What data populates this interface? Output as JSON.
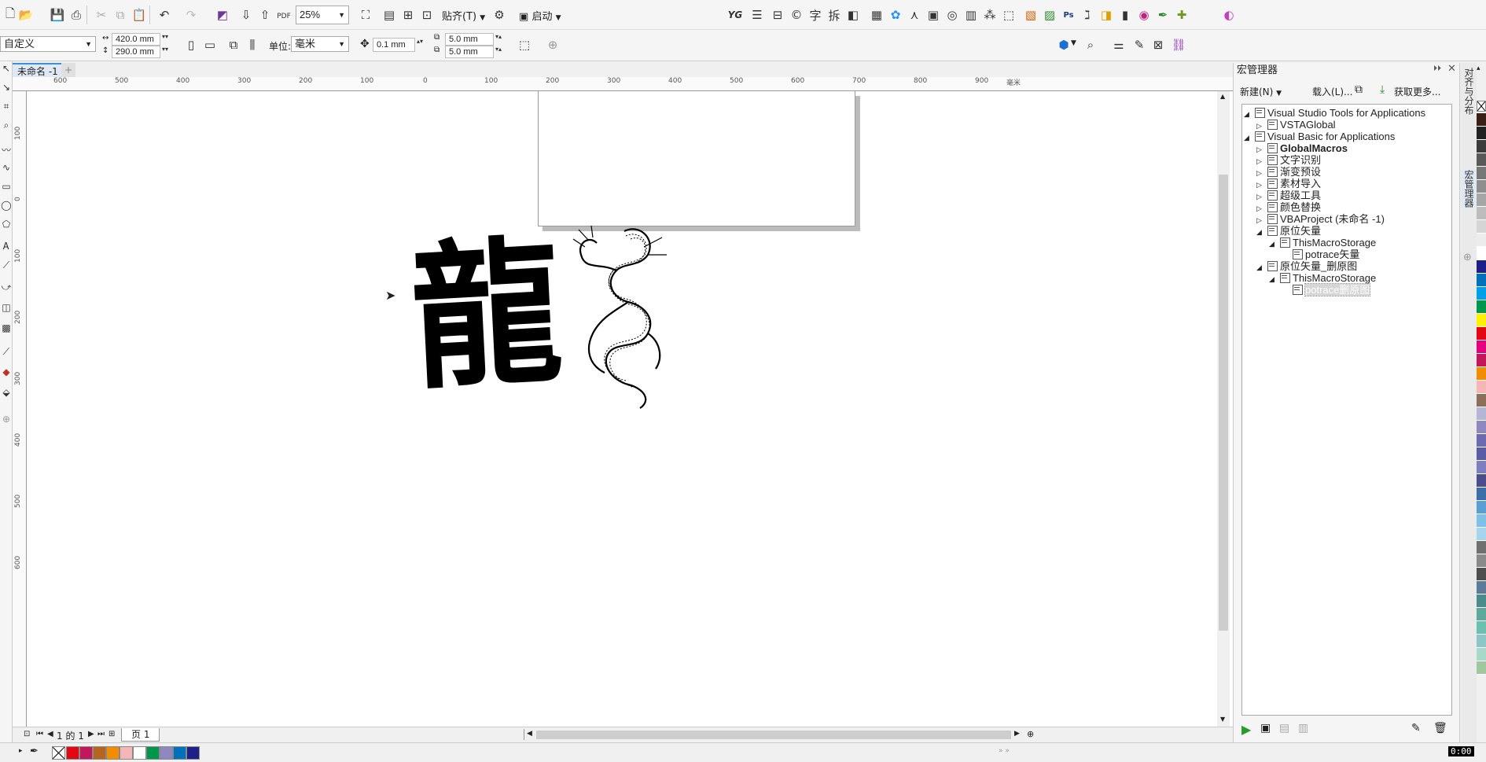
{
  "toolbar1": {
    "zoom": "25%",
    "snap_label": "贴齐(T)",
    "launch_label": "启动",
    "pdf_label": "PDF",
    "yg_label": "YG",
    "char_label": "字",
    "split_label": "拆"
  },
  "toolbar2": {
    "page_size_name": "自定义",
    "width": "420.0 mm",
    "height": "290.0 mm",
    "units_label": "单位:",
    "units_value": "毫米",
    "nudge": "0.1 mm",
    "dup_x": "5.0 mm",
    "dup_y": "5.0 mm"
  },
  "document": {
    "tab_label": "未命名 -1",
    "page_nav": "1 的 1",
    "page_tab": "页 1"
  },
  "ruler": {
    "h_labels": [
      "600",
      "500",
      "400",
      "300",
      "200",
      "100",
      "0",
      "100",
      "200",
      "300",
      "400",
      "500",
      "600",
      "700",
      "800",
      "900"
    ],
    "h_unit": "毫米",
    "v_labels": [
      "100",
      "0",
      "100",
      "200",
      "300",
      "400",
      "500",
      "600"
    ]
  },
  "canvas": {
    "calligraphy_text": "龍"
  },
  "macro_manager": {
    "title": "宏管理器",
    "new_label": "新建(N)",
    "load_label": "载入(L)...",
    "get_more_label": "获取更多...",
    "tree": [
      {
        "label": "Visual Studio Tools for Applications",
        "level": 0,
        "expanded": true
      },
      {
        "label": "VSTAGlobal",
        "level": 1,
        "expanded": false
      },
      {
        "label": "Visual Basic for Applications",
        "level": 0,
        "expanded": true
      },
      {
        "label": "GlobalMacros",
        "level": 1,
        "expanded": false,
        "bold": true
      },
      {
        "label": "文字识别",
        "level": 1,
        "expanded": false
      },
      {
        "label": "渐变预设",
        "level": 1,
        "expanded": false
      },
      {
        "label": "素材导入",
        "level": 1,
        "expanded": false
      },
      {
        "label": "超级工具",
        "level": 1,
        "expanded": false
      },
      {
        "label": "颜色替换",
        "level": 1,
        "expanded": false
      },
      {
        "label": "VBAProject (未命名 -1)",
        "level": 1,
        "expanded": false
      },
      {
        "label": "原位矢量",
        "level": 1,
        "expanded": true
      },
      {
        "label": "ThisMacroStorage",
        "level": 2,
        "expanded": true
      },
      {
        "label": "potrace矢量",
        "level": 3,
        "leaf": true
      },
      {
        "label": "原位矢量_删原图",
        "level": 1,
        "expanded": true
      },
      {
        "label": "ThisMacroStorage",
        "level": 2,
        "expanded": true
      },
      {
        "label": "potrace删原图",
        "level": 3,
        "leaf": true,
        "selected": true
      }
    ]
  },
  "side_tabs": [
    "对齐与分布",
    "宏管理器"
  ],
  "palette": {
    "swatches": [
      "#e30613",
      "#c2185b",
      "#b5651d",
      "#f28c00",
      "#f4b6b6",
      "#ffffff",
      "#00964b",
      "#8e87c0",
      "#0072bc",
      "#1d2088"
    ]
  },
  "color_strip": [
    "#3a1f14",
    "#222222",
    "#3b3b3b",
    "#595959",
    "#777777",
    "#8e8e8e",
    "#a6a6a6",
    "#bdbdbd",
    "#d5d5d5",
    "#ececec",
    "#ffffff",
    "#1d2088",
    "#0072bc",
    "#00a0e9",
    "#00964b",
    "#fff100",
    "#e30613",
    "#e4007f",
    "#c2185b",
    "#f28c00",
    "#f4b6b6",
    "#8c6e5a",
    "#b5b5d6",
    "#8e87c0",
    "#6e6ab0",
    "#5b5ba8",
    "#7f7fbf",
    "#4d4d8c",
    "#3c6fa8",
    "#5a9fd4",
    "#7fc1e6",
    "#a6d5ee",
    "#707070",
    "#8a8a8a",
    "#4e4e4e",
    "#5c7a99",
    "#4a8c8c",
    "#5fa89c",
    "#6dbfae",
    "#8cc7c7",
    "#a8d9c8",
    "#a0c8a0"
  ]
}
